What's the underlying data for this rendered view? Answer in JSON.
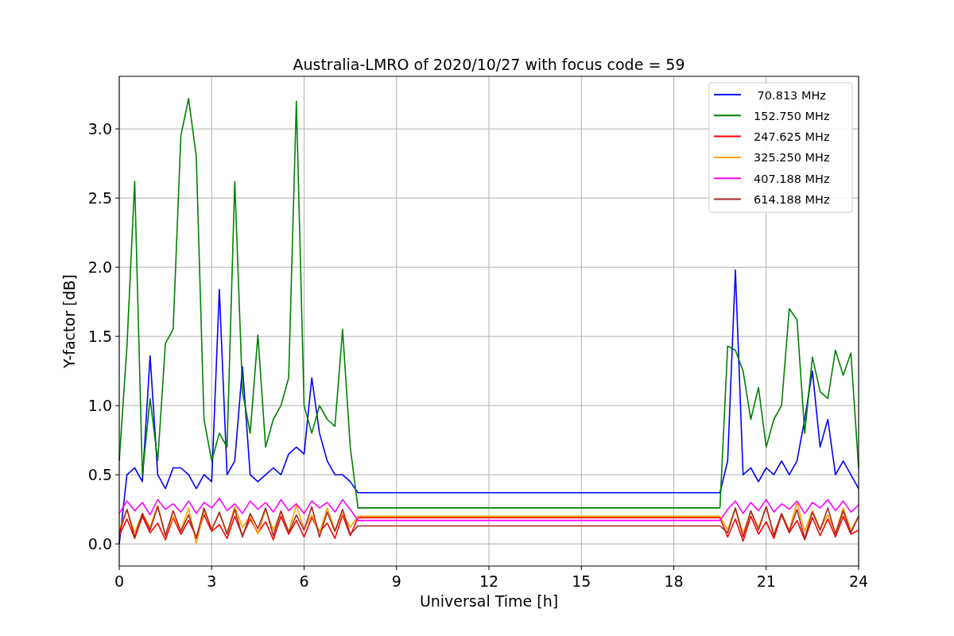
{
  "chart_data": {
    "type": "line",
    "title": "Australia-LMRO of 2020/10/27 with focus code = 59",
    "xlabel": "Universal Time [h]",
    "ylabel": "Y-factor [dB]",
    "x": [
      0,
      0.25,
      0.5,
      0.75,
      1,
      1.25,
      1.5,
      1.75,
      2,
      2.25,
      2.5,
      2.75,
      3,
      3.25,
      3.5,
      3.75,
      4,
      4.25,
      4.5,
      4.75,
      5,
      5.25,
      5.5,
      5.75,
      6,
      6.25,
      6.5,
      6.75,
      7,
      7.25,
      7.5,
      7.75,
      19.5,
      19.75,
      20,
      20.25,
      20.5,
      20.75,
      21,
      21.25,
      21.5,
      21.75,
      22,
      22.25,
      22.5,
      22.75,
      23,
      23.25,
      23.5,
      23.75,
      24
    ],
    "xlim": [
      0,
      24
    ],
    "ylim": [
      -0.16,
      3.38
    ],
    "xticks": [
      0,
      3,
      6,
      9,
      12,
      15,
      18,
      21,
      24
    ],
    "yticks": [
      {
        "value": 0,
        "label": "0.0"
      },
      {
        "value": 0.5,
        "label": "0.5"
      },
      {
        "value": 1,
        "label": "1.0"
      },
      {
        "value": 1.5,
        "label": "1.5"
      },
      {
        "value": 2,
        "label": "2.0"
      },
      {
        "value": 2.5,
        "label": "2.5"
      },
      {
        "value": 3,
        "label": "3.0"
      }
    ],
    "grid": true,
    "legend": "upper right",
    "series": [
      {
        "name": " 70.813 MHz",
        "color": "#0000ff",
        "values": [
          0.0,
          0.5,
          0.55,
          0.45,
          1.36,
          0.5,
          0.4,
          0.55,
          0.55,
          0.5,
          0.4,
          0.5,
          0.45,
          1.84,
          0.5,
          0.6,
          1.28,
          0.5,
          0.45,
          0.5,
          0.55,
          0.5,
          0.65,
          0.7,
          0.65,
          1.2,
          0.8,
          0.6,
          0.5,
          0.5,
          0.45,
          0.37,
          0.37,
          0.6,
          1.98,
          0.5,
          0.55,
          0.45,
          0.55,
          0.5,
          0.6,
          0.5,
          0.6,
          0.9,
          1.25,
          0.7,
          0.9,
          0.5,
          0.6,
          0.5,
          0.4
        ]
      },
      {
        "name": "152.750 MHz",
        "color": "#008000",
        "values": [
          0.6,
          1.43,
          2.62,
          0.5,
          1.05,
          0.6,
          1.45,
          1.55,
          2.95,
          3.22,
          2.8,
          0.9,
          0.6,
          0.8,
          0.7,
          2.62,
          1.1,
          0.8,
          1.51,
          0.7,
          0.9,
          1.0,
          1.2,
          3.2,
          1.0,
          0.8,
          1.0,
          0.9,
          0.85,
          1.55,
          0.7,
          0.26,
          0.26,
          1.43,
          1.4,
          1.25,
          0.9,
          1.13,
          0.7,
          0.9,
          1.0,
          1.7,
          1.62,
          0.8,
          1.35,
          1.1,
          1.05,
          1.4,
          1.22,
          1.38,
          0.55
        ]
      },
      {
        "name": "247.625 MHz",
        "color": "#ff0000",
        "values": [
          0.06,
          0.18,
          0.04,
          0.2,
          0.08,
          0.15,
          0.03,
          0.19,
          0.07,
          0.17,
          0.05,
          0.21,
          0.09,
          0.14,
          0.04,
          0.2,
          0.06,
          0.18,
          0.08,
          0.16,
          0.03,
          0.2,
          0.07,
          0.17,
          0.05,
          0.19,
          0.09,
          0.15,
          0.04,
          0.21,
          0.06,
          0.19,
          0.19,
          0.05,
          0.18,
          0.02,
          0.2,
          0.07,
          0.16,
          0.04,
          0.21,
          0.08,
          0.17,
          0.03,
          0.19,
          0.06,
          0.18,
          0.05,
          0.2,
          0.07,
          0.1
        ]
      },
      {
        "name": "325.250 MHz",
        "color": "#ffa500",
        "values": [
          0.1,
          0.25,
          0.08,
          0.22,
          0.12,
          0.28,
          0.06,
          0.2,
          0.1,
          0.26,
          0.0,
          0.24,
          0.11,
          0.22,
          0.08,
          0.27,
          0.12,
          0.2,
          0.07,
          0.25,
          0.1,
          0.23,
          0.09,
          0.28,
          0.11,
          0.21,
          0.08,
          0.26,
          0.1,
          0.22,
          0.12,
          0.2,
          0.2,
          0.1,
          0.26,
          0.08,
          0.23,
          0.12,
          0.27,
          0.07,
          0.22,
          0.1,
          0.3,
          0.09,
          0.24,
          0.11,
          0.21,
          0.08,
          0.26,
          0.1,
          0.2
        ]
      },
      {
        "name": "407.188 MHz",
        "color": "#ff00ff",
        "values": [
          0.22,
          0.31,
          0.24,
          0.3,
          0.21,
          0.32,
          0.25,
          0.29,
          0.23,
          0.31,
          0.22,
          0.3,
          0.26,
          0.33,
          0.24,
          0.29,
          0.22,
          0.31,
          0.25,
          0.3,
          0.23,
          0.32,
          0.24,
          0.29,
          0.22,
          0.31,
          0.26,
          0.3,
          0.23,
          0.32,
          0.25,
          0.17,
          0.17,
          0.25,
          0.31,
          0.22,
          0.3,
          0.24,
          0.32,
          0.23,
          0.29,
          0.25,
          0.31,
          0.22,
          0.3,
          0.26,
          0.32,
          0.24,
          0.31,
          0.23,
          0.28
        ]
      },
      {
        "name": "614.188 MHz",
        "color": "#a52a2a",
        "values": [
          0.08,
          0.25,
          0.05,
          0.22,
          0.1,
          0.27,
          0.06,
          0.24,
          0.09,
          0.21,
          0.04,
          0.26,
          0.1,
          0.23,
          0.07,
          0.25,
          0.05,
          0.22,
          0.11,
          0.26,
          0.06,
          0.24,
          0.08,
          0.21,
          0.1,
          0.27,
          0.05,
          0.23,
          0.09,
          0.25,
          0.07,
          0.13,
          0.13,
          0.08,
          0.26,
          0.05,
          0.24,
          0.1,
          0.27,
          0.06,
          0.22,
          0.09,
          0.25,
          0.04,
          0.23,
          0.1,
          0.26,
          0.07,
          0.24,
          0.08,
          0.2
        ]
      }
    ]
  }
}
